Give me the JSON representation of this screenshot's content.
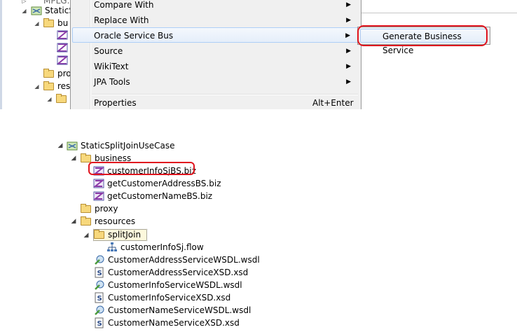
{
  "top_tree": {
    "row0_label": "MPLG...",
    "row1_label": "StaticS",
    "row2_label": "bu",
    "row6_label": "pro",
    "row7_label": "reso"
  },
  "context_menu": {
    "items": [
      {
        "label": "Compare With",
        "shortcut": "",
        "submenu": true
      },
      {
        "label": "Replace With",
        "shortcut": "",
        "submenu": true
      },
      {
        "label": "Oracle Service Bus",
        "shortcut": "",
        "submenu": true
      },
      {
        "label": "Source",
        "shortcut": "",
        "submenu": true
      },
      {
        "label": "WikiText",
        "shortcut": "",
        "submenu": true
      },
      {
        "label": "JPA Tools",
        "shortcut": "",
        "submenu": true
      },
      {
        "label": "Properties",
        "shortcut": "Alt+Enter",
        "submenu": false
      }
    ],
    "submenu_arrow": "▶"
  },
  "submenu": {
    "item_label": "Generate Business Service"
  },
  "project_tree": {
    "project": "StaticSplitJoinUseCase",
    "business_folder": "business",
    "business_files": [
      "customerInfoSjBS.biz",
      "getCustomerAddressBS.biz",
      "getCustomerNameBS.biz"
    ],
    "proxy_folder": "proxy",
    "resources_folder": "resources",
    "splitjoin_folder": "splitJoin",
    "flow_file": "customerInfoSj.flow",
    "resource_files": [
      "CustomerAddressServiceWSDL.wsdl",
      "CustomerAddressServiceXSD.xsd",
      "CustomerInfoServiceWSDL.wsdl",
      "CustomerInfoServiceXSD.xsd",
      "CustomerNameServiceWSDL.wsdl",
      "CustomerNameServiceXSD.xsd"
    ]
  },
  "colors": {
    "highlight_annotation": "#e0141e",
    "menu_background": "#f0f0f0",
    "menu_hover": "#e5eefa",
    "folder": "#f7d87c"
  },
  "icons": {
    "project": "osb-project-icon",
    "folder": "folder-icon",
    "biz": "business-service-icon",
    "flow": "split-join-flow-icon",
    "wsdl": "wsdl-icon",
    "xsd": "xsd-icon"
  }
}
